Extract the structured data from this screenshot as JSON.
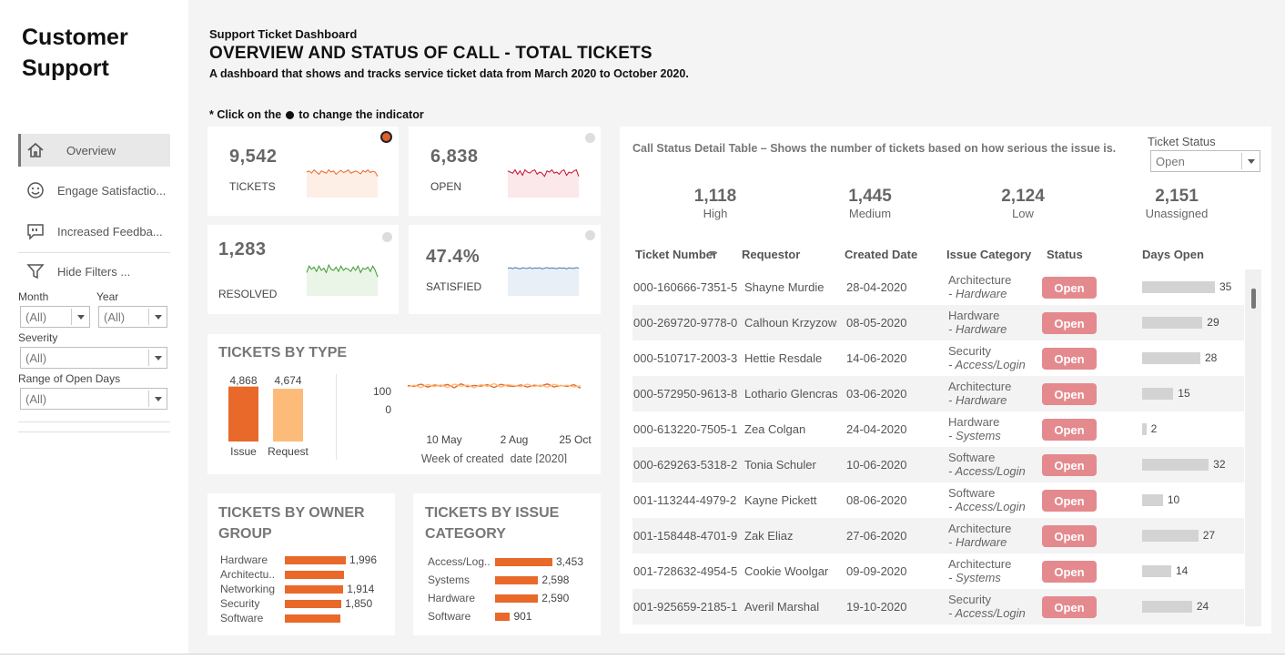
{
  "brand": {
    "line1": "Customer",
    "line2": "Support"
  },
  "nav": [
    {
      "label": "Overview",
      "icon": "home-icon"
    },
    {
      "label": "Engage Satisfactio...",
      "icon": "smiley-icon"
    },
    {
      "label": "Increased Feedba...",
      "icon": "feedback-icon"
    },
    {
      "label": "Hide Filters ...",
      "icon": "filter-icon"
    }
  ],
  "filters": {
    "month": {
      "label": "Month",
      "value": "(All)"
    },
    "year": {
      "label": "Year",
      "value": "(All)"
    },
    "severity": {
      "label": "Severity",
      "value": "(All)"
    },
    "open_days": {
      "label": "Range of Open Days",
      "value": "(All)"
    }
  },
  "header": {
    "kicker": "Support Ticket Dashboard",
    "title": "OVERVIEW AND STATUS OF CALL - TOTAL TICKETS",
    "subtitle": "A dashboard that shows and tracks service ticket data from March 2020 to October 2020.",
    "hint_pre": "* Click on the",
    "hint_post": "to change the indicator"
  },
  "kpis": [
    {
      "value": "9,542",
      "label": "TICKETS",
      "color": "#e8692a",
      "fill": "#fdeee6",
      "active": true
    },
    {
      "value": "6,838",
      "label": "OPEN",
      "color": "#c8102e",
      "fill": "#fbe8ea",
      "active": false
    },
    {
      "value": "1,283",
      "label": "RESOLVED",
      "color": "#3a9a2e",
      "fill": "#eaf5e8",
      "active": false
    },
    {
      "value": "47.4%",
      "label": "SATISFIED",
      "color": "#4a78b0",
      "fill": "#e9eff6",
      "active": false
    }
  ],
  "tickets_by_type": {
    "title": "TICKETS BY TYPE",
    "chart_data": {
      "type": "bar",
      "categories": [
        "Issue",
        "Request"
      ],
      "values": [
        4868,
        4674
      ],
      "value_labels": [
        "4,868",
        "4,674"
      ],
      "colors": [
        "#e8692a",
        "#fdbb7a"
      ]
    },
    "line_chart": {
      "type": "line",
      "y_ticks": [
        "100",
        "0"
      ],
      "x_ticks": [
        "10 May",
        "2 Aug",
        "25 Oct"
      ],
      "xlabel": "Week of created_date [2020]",
      "series": [
        {
          "color": "#e8692a",
          "values": [
            132,
            128,
            140,
            124,
            135,
            130,
            138,
            120,
            142,
            126,
            133,
            129,
            137,
            122,
            139,
            131,
            127,
            136,
            124,
            134,
            130,
            141,
            125,
            133,
            128,
            137,
            118
          ]
        },
        {
          "color": "#fdbb7a",
          "values": [
            125,
            134,
            121,
            138,
            127,
            136,
            122,
            140,
            129,
            135,
            120,
            138,
            128,
            143,
            124,
            137,
            132,
            126,
            140,
            127,
            135,
            123,
            139,
            130,
            134,
            125,
            131
          ]
        }
      ]
    }
  },
  "owner_group": {
    "title_line1": "TICKETS BY OWNER",
    "title_line2": "GROUP",
    "chart_data": {
      "type": "bar",
      "categories": [
        "Hardware",
        "Architectu..",
        "Networking",
        "Security",
        "Software"
      ],
      "values": [
        1996,
        1950,
        1914,
        1850,
        1820
      ],
      "value_labels": [
        "1,996",
        "",
        "1,914",
        "1,850",
        ""
      ]
    }
  },
  "issue_category": {
    "title_line1": "TICKETS BY ISSUE",
    "title_line2": "CATEGORY",
    "chart_data": {
      "type": "bar",
      "categories": [
        "Access/Log..",
        "Systems",
        "Hardware",
        "Software"
      ],
      "values": [
        3453,
        2598,
        2590,
        901
      ],
      "value_labels": [
        "3,453",
        "2,598",
        "2,590",
        "901"
      ]
    }
  },
  "detail": {
    "title": "Call Status Detail Table – Shows the number of tickets based on how serious the issue is.",
    "status_filter": {
      "label": "Ticket Status",
      "value": "Open"
    },
    "severity": [
      {
        "value": "1,118",
        "label": "High"
      },
      {
        "value": "1,445",
        "label": "Medium"
      },
      {
        "value": "2,124",
        "label": "Low"
      },
      {
        "value": "2,151",
        "label": "Unassigned"
      }
    ],
    "columns": [
      "Ticket Number",
      "Requestor",
      "Created Date",
      "Issue Category",
      "Status",
      "Days Open"
    ],
    "rows": [
      {
        "ticket": "000-160666-7351-5",
        "requestor": "Shayne Murdie",
        "date": "28-04-2020",
        "cat": "Architecture",
        "sub": "- Hardware",
        "status": "Open",
        "days": 35
      },
      {
        "ticket": "000-269720-9778-0",
        "requestor": "Calhoun Krzyzowski",
        "date": "08-05-2020",
        "cat": "Hardware",
        "sub": "- Hardware",
        "status": "Open",
        "days": 29
      },
      {
        "ticket": "000-510717-2003-3",
        "requestor": "Hettie Resdale",
        "date": "14-06-2020",
        "cat": "Security",
        "sub": "- Access/Login",
        "status": "Open",
        "days": 28
      },
      {
        "ticket": "000-572950-9613-8",
        "requestor": "Lothario Glencrash",
        "date": "03-06-2020",
        "cat": "Architecture",
        "sub": "- Hardware",
        "status": "Open",
        "days": 15
      },
      {
        "ticket": "000-613220-7505-1",
        "requestor": "Zea Colgan",
        "date": "24-04-2020",
        "cat": "Hardware",
        "sub": "- Systems",
        "status": "Open",
        "days": 2
      },
      {
        "ticket": "000-629263-5318-2",
        "requestor": "Tonia Schuler",
        "date": "10-06-2020",
        "cat": "Software",
        "sub": "- Access/Login",
        "status": "Open",
        "days": 32
      },
      {
        "ticket": "001-113244-4979-2",
        "requestor": "Kayne Pickett",
        "date": "08-06-2020",
        "cat": "Software",
        "sub": "- Access/Login",
        "status": "Open",
        "days": 10
      },
      {
        "ticket": "001-158448-4701-9",
        "requestor": "Zak Eliaz",
        "date": "27-06-2020",
        "cat": "Architecture",
        "sub": "- Hardware",
        "status": "Open",
        "days": 27
      },
      {
        "ticket": "001-728632-4954-5",
        "requestor": "Cookie Woolgar",
        "date": "09-09-2020",
        "cat": "Architecture",
        "sub": "- Systems",
        "status": "Open",
        "days": 14
      },
      {
        "ticket": "001-925659-2185-1",
        "requestor": "Averil Marshal",
        "date": "19-10-2020",
        "cat": "Security",
        "sub": "- Access/Login",
        "status": "Open",
        "days": 24
      }
    ]
  }
}
